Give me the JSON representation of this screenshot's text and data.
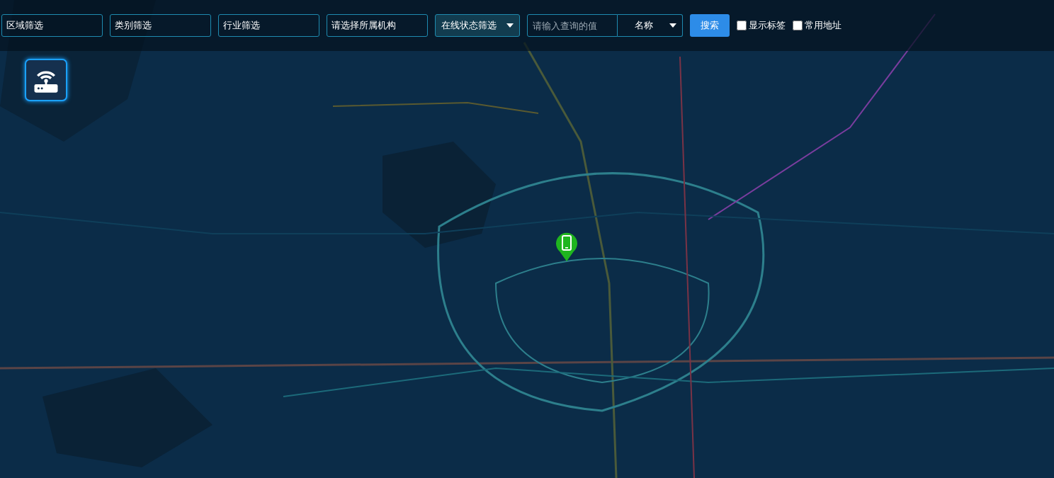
{
  "filters": [
    {
      "value": "区域筛选"
    },
    {
      "value": "类别筛选"
    },
    {
      "value": "行业筛选"
    },
    {
      "value": "请选择所属机构"
    }
  ],
  "status_filter": {
    "value": "在线状态筛选"
  },
  "query": {
    "placeholder": "请输入查询的值",
    "field": "名称"
  },
  "search_button": "搜索",
  "options": [
    {
      "label": "显示标签",
      "checked": false
    },
    {
      "label": "常用地址",
      "checked": false
    }
  ]
}
